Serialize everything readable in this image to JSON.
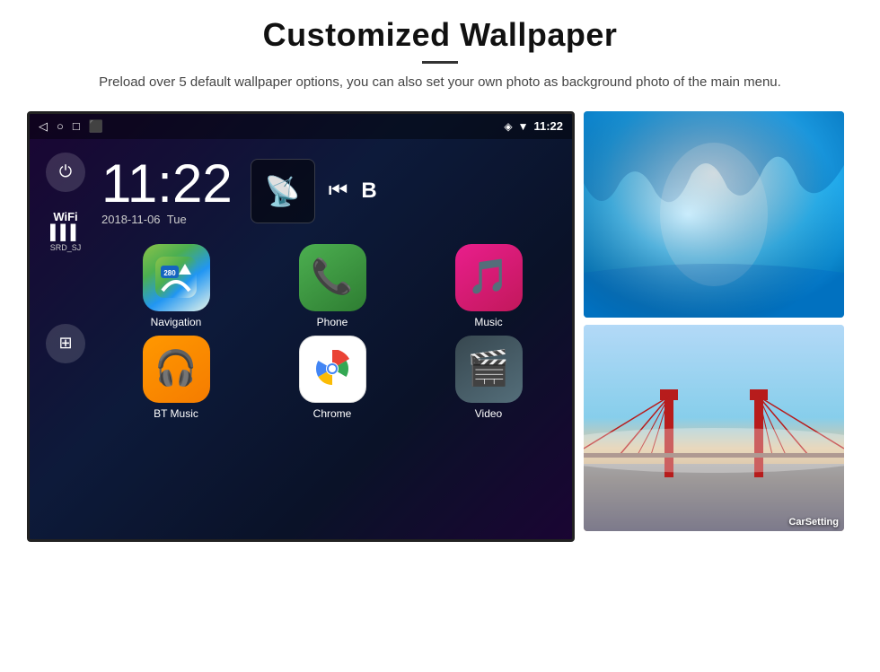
{
  "header": {
    "title": "Customized Wallpaper",
    "subtitle": "Preload over 5 default wallpaper options, you can also set your own photo as background photo of the main menu."
  },
  "screen": {
    "time": "11:22",
    "date": "2018-11-06",
    "day": "Tue",
    "wifi_label": "WiFi",
    "wifi_network": "SRD_SJ",
    "status_time": "11:22"
  },
  "apps": [
    {
      "id": "navigation",
      "label": "Navigation",
      "type": "nav"
    },
    {
      "id": "phone",
      "label": "Phone",
      "type": "phone"
    },
    {
      "id": "music",
      "label": "Music",
      "type": "music"
    },
    {
      "id": "bt-music",
      "label": "BT Music",
      "type": "bt"
    },
    {
      "id": "chrome",
      "label": "Chrome",
      "type": "chrome"
    },
    {
      "id": "video",
      "label": "Video",
      "type": "video"
    }
  ],
  "thumbnails": [
    {
      "id": "ice-cave",
      "label": "",
      "type": "ice"
    },
    {
      "id": "bridge",
      "label": "CarSetting",
      "type": "bridge"
    }
  ],
  "sidebar": {
    "power_label": "⏻",
    "apps_label": "⊞"
  }
}
